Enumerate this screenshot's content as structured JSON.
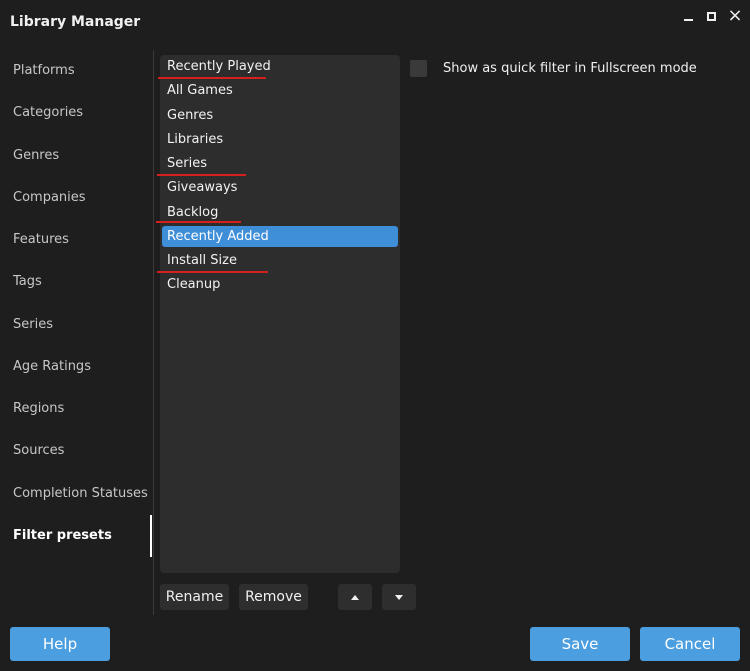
{
  "window": {
    "title": "Library Manager",
    "minimize_icon": "minimize-icon",
    "maximize_icon": "maximize-icon",
    "close_icon": "close-icon",
    "close_glyph": "×"
  },
  "sidebar": {
    "items": [
      {
        "label": "Platforms"
      },
      {
        "label": "Categories"
      },
      {
        "label": "Genres"
      },
      {
        "label": "Companies"
      },
      {
        "label": "Features"
      },
      {
        "label": "Tags"
      },
      {
        "label": "Series"
      },
      {
        "label": "Age Ratings"
      },
      {
        "label": "Regions"
      },
      {
        "label": "Sources"
      },
      {
        "label": "Completion Statuses"
      },
      {
        "label": "Filter presets"
      }
    ],
    "active": "Filter presets"
  },
  "presets": {
    "items": [
      {
        "label": "Recently Played"
      },
      {
        "label": "All Games"
      },
      {
        "label": "Genres"
      },
      {
        "label": "Libraries"
      },
      {
        "label": "Series"
      },
      {
        "label": "Giveaways"
      },
      {
        "label": "Backlog"
      },
      {
        "label": "Recently Added"
      },
      {
        "label": "Install Size"
      },
      {
        "label": "Cleanup"
      }
    ],
    "selected": "Recently Added",
    "annotation_color": "#d62020"
  },
  "options": {
    "quick_filter_label": "Show as quick filter in Fullscreen mode",
    "quick_filter_checked": false
  },
  "actions": {
    "rename": "Rename",
    "remove": "Remove",
    "move_up_icon": "arrow-up-icon",
    "move_down_icon": "arrow-down-icon"
  },
  "footer": {
    "help": "Help",
    "save": "Save",
    "cancel": "Cancel"
  },
  "colors": {
    "background": "#1e1e1e",
    "list_background": "#2d2d2d",
    "accent": "#3f8ed8",
    "primary_button": "#4b9ee0"
  }
}
